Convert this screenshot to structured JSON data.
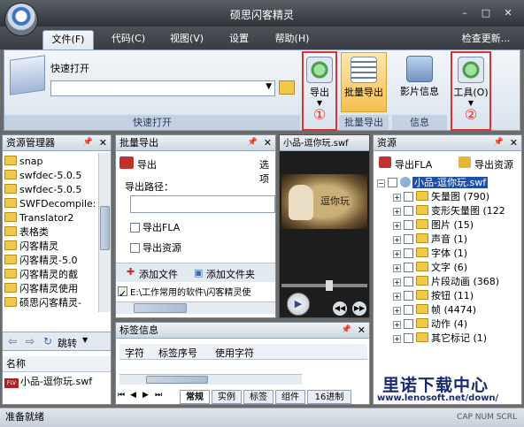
{
  "window": {
    "title": "硕思闪客精灵"
  },
  "menu": {
    "tabs": [
      "文件(F)",
      "代码(C)",
      "视图(V)",
      "设置",
      "帮助(H)"
    ],
    "check_update": "检查更新..."
  },
  "ribbon": {
    "quick_open_label": "快速打开",
    "quick_open_group": "快速打开",
    "export_label": "导出",
    "batch_export_label": "批量导出",
    "batch_export_group": "批量导出",
    "movie_info_label": "影片信息",
    "info_group": "信息",
    "tools_label": "工具(O)",
    "annotation_1": "①",
    "annotation_2": "②"
  },
  "resource_manager": {
    "title": "资源管理器",
    "folders": [
      "snap",
      "swfdec-5.0.5",
      "swfdec-5.0.5",
      "SWFDecompile:",
      "Translator2",
      "表格类",
      "闪客精灵",
      "闪客精灵-5.0",
      "闪客精灵的截",
      "闪客精灵使用",
      "硕思闪客精灵-"
    ],
    "jump_label": "跳转",
    "name_header": "名称",
    "file_name": "小品-逗你玩.swf"
  },
  "batch_export": {
    "title": "批量导出",
    "export_label": "导出",
    "options_label": "选项",
    "path_label": "导出路径：",
    "fla_label": "导出FLA",
    "resource_label": "导出资源",
    "add_file": "添加文件",
    "add_folder": "添加文件夹",
    "file_entry": "E:\\工作常用的软件\\闪客精灵使"
  },
  "preview": {
    "title": "小品-逗你玩.swf",
    "scene_text": "逗你玩"
  },
  "tag_info": {
    "title": "标签信息",
    "columns": [
      "字符",
      "标签序号",
      "使用字符"
    ],
    "tabs": [
      "常规",
      "实例",
      "标签",
      "组件",
      "16进制"
    ]
  },
  "resources": {
    "title": "资源",
    "export_fla": "导出FLA",
    "export_resources": "导出资源",
    "root": "小品-逗你玩.swf",
    "items": [
      {
        "label": "矢量图",
        "count": "(790)"
      },
      {
        "label": "变形矢量图",
        "count": "(122"
      },
      {
        "label": "图片",
        "count": "(15)"
      },
      {
        "label": "声音",
        "count": "(1)"
      },
      {
        "label": "字体",
        "count": "(1)"
      },
      {
        "label": "文字",
        "count": "(6)"
      },
      {
        "label": "片段动画",
        "count": "(368)"
      },
      {
        "label": "按钮",
        "count": "(11)"
      },
      {
        "label": "帧",
        "count": "(4474)"
      },
      {
        "label": "动作",
        "count": "(4)"
      },
      {
        "label": "其它标记",
        "count": "(1)"
      }
    ]
  },
  "watermark": {
    "brand": "里诺下载中心",
    "url": "www.lenosoft.net/down/"
  },
  "status": {
    "text": "准备就绪",
    "indicators": "CAP NUM SCRL"
  }
}
